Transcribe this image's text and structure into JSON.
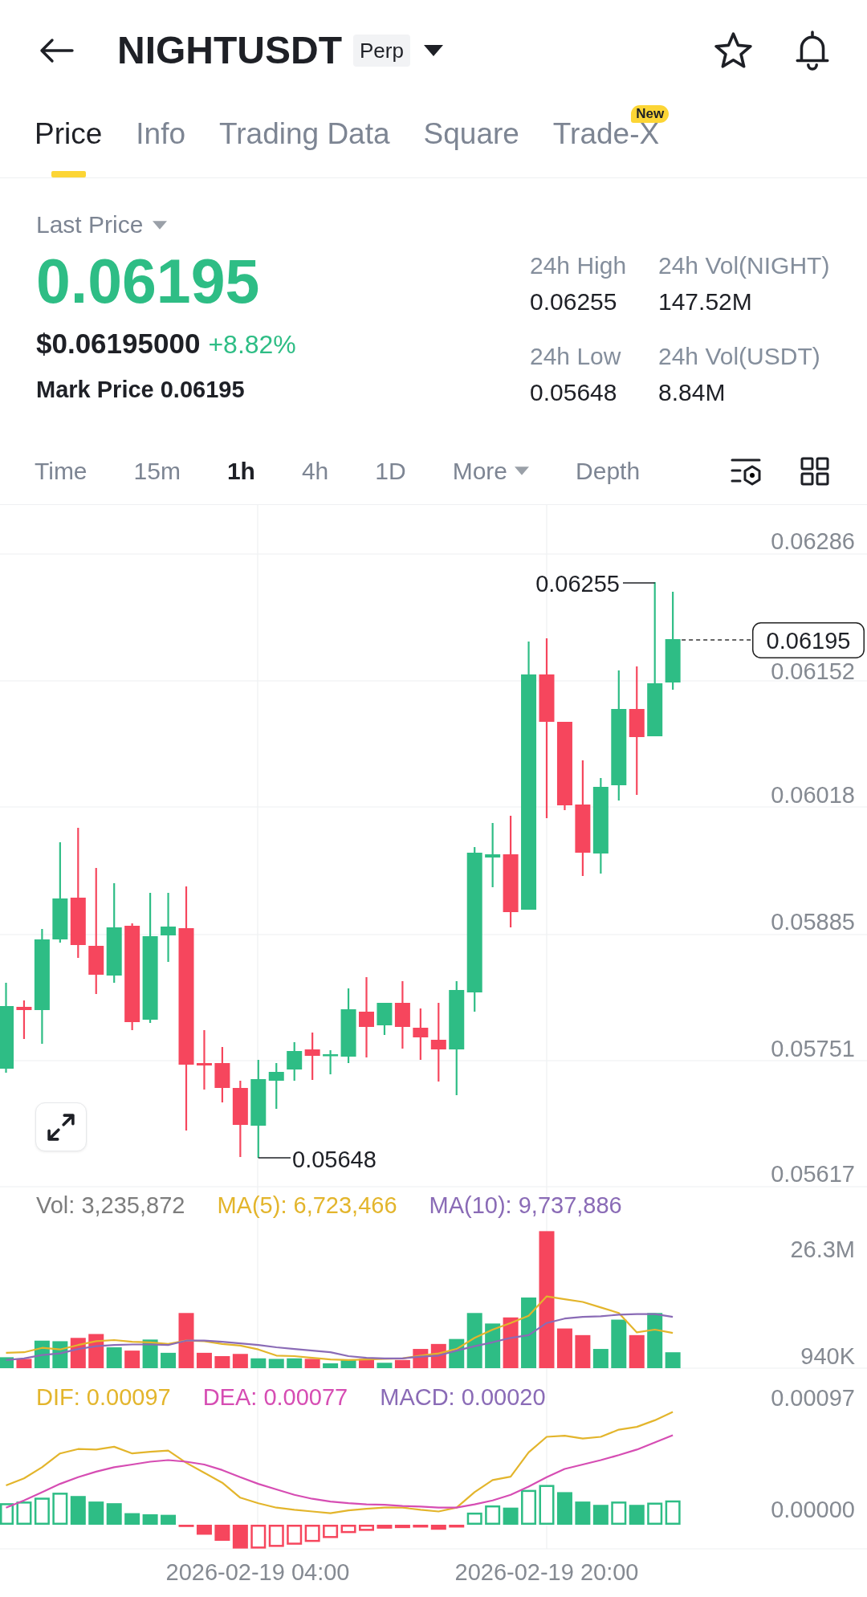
{
  "header": {
    "title": "NIGHTUSDT",
    "badge": "Perp"
  },
  "tabs": [
    {
      "label": "Price",
      "selected": true
    },
    {
      "label": "Info",
      "selected": false
    },
    {
      "label": "Trading Data",
      "selected": false
    },
    {
      "label": "Square",
      "selected": false
    },
    {
      "label": "Trade-X",
      "selected": false,
      "badge": "New"
    }
  ],
  "price": {
    "type_label": "Last Price",
    "last": "0.06195",
    "usd": "$0.06195000",
    "change": "+8.82%",
    "mark_label": "Mark Price",
    "mark": "0.06195"
  },
  "stats": [
    {
      "label": "24h High",
      "value": "0.06255"
    },
    {
      "label": "24h Vol(NIGHT)",
      "value": "147.52M"
    },
    {
      "label": "24h Low",
      "value": "0.05648"
    },
    {
      "label": "24h Vol(USDT)",
      "value": "8.84M"
    }
  ],
  "intervals": [
    {
      "label": "Time",
      "kind": "option",
      "selected": false
    },
    {
      "label": "15m",
      "kind": "option",
      "selected": false
    },
    {
      "label": "1h",
      "kind": "option",
      "selected": true
    },
    {
      "label": "4h",
      "kind": "option",
      "selected": false
    },
    {
      "label": "1D",
      "kind": "option",
      "selected": false
    },
    {
      "label": "More",
      "kind": "dropdown",
      "selected": false
    },
    {
      "label": "Depth",
      "kind": "option",
      "selected": false
    }
  ],
  "chart": {
    "price_axis": [
      "0.06286",
      "0.06152",
      "0.06018",
      "0.05885",
      "0.05751",
      "0.05617"
    ],
    "high_label": "0.06255",
    "low_label": "0.05648",
    "current_price": "0.06195"
  },
  "volume": {
    "legend": [
      {
        "label": "Vol: 3,235,872",
        "color": "#7d7d7d"
      },
      {
        "label": "MA(5): 6,723,466",
        "color": "#e3b52c"
      },
      {
        "label": "MA(10): 9,737,886",
        "color": "#8a6bb6"
      }
    ],
    "axis": [
      "26.3M",
      "940K"
    ]
  },
  "macd": {
    "legend": [
      {
        "label": "DIF: 0.00097",
        "color": "#e3b52c"
      },
      {
        "label": "DEA: 0.00077",
        "color": "#d64db3"
      },
      {
        "label": "MACD: 0.00020",
        "color": "#8a6bb6"
      }
    ],
    "axis": [
      "0.00097",
      "0.00000"
    ]
  },
  "time_axis": [
    "2026-02-19 04:00",
    "2026-02-19 20:00"
  ]
}
